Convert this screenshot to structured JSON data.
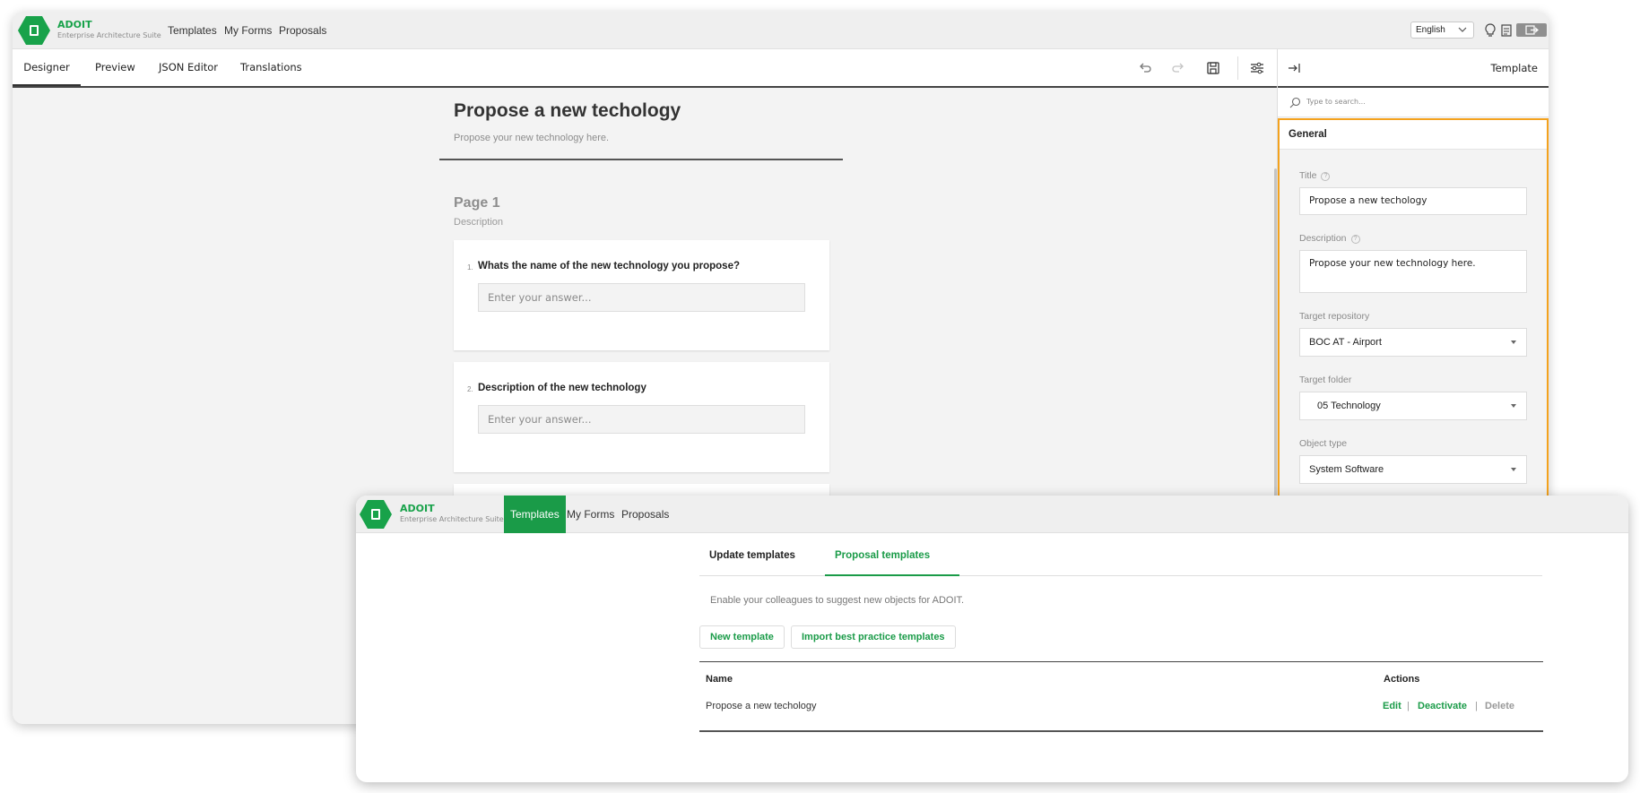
{
  "back_window": {
    "brand": {
      "name": "ADOIT",
      "subtitle": "Enterprise Architecture Suite"
    },
    "top_nav": [
      "Templates",
      "My Forms",
      "Proposals"
    ],
    "language": "English",
    "designer_tabs": [
      "Designer",
      "Preview",
      "JSON Editor",
      "Translations"
    ],
    "survey": {
      "title": "Propose a new techology",
      "description": "Propose your new technology here.",
      "page_title": "Page 1",
      "page_description": "Description",
      "questions": [
        {
          "number": "1.",
          "text": "Whats the name of the new technology you propose?",
          "placeholder": "Enter your answer..."
        },
        {
          "number": "2.",
          "text": "Description of the new technology",
          "placeholder": "Enter your answer..."
        }
      ]
    },
    "panel": {
      "header": "Template",
      "search_placeholder": "Type to search...",
      "section": "General",
      "fields": {
        "title_label": "Title",
        "title_value": "Propose a new techology",
        "description_label": "Description",
        "description_value": "Propose your new technology here.",
        "repo_label": "Target repository",
        "repo_value": "BOC AT - Airport",
        "folder_label": "Target folder",
        "folder_value": "05 Technology",
        "type_label": "Object type",
        "type_value": "System Software"
      }
    }
  },
  "front_window": {
    "brand": {
      "name": "ADOIT",
      "subtitle": "Enterprise Architecture Suite"
    },
    "top_nav": [
      "Templates",
      "My Forms",
      "Proposals"
    ],
    "active_nav": "Templates",
    "tabs": [
      "Update templates",
      "Proposal templates"
    ],
    "active_tab": "Proposal templates",
    "info": "Enable your colleagues to suggest new objects for ADOIT.",
    "buttons": {
      "new_template": "New template",
      "import": "Import best practice templates"
    },
    "table": {
      "columns": [
        "Name",
        "Actions"
      ],
      "rows": [
        {
          "name": "Propose a new techology",
          "actions": [
            "Edit",
            "Deactivate",
            "Delete"
          ]
        }
      ]
    }
  },
  "colors": {
    "brand_green": "#1a9b48",
    "panel_accent": "#f4a21d"
  }
}
